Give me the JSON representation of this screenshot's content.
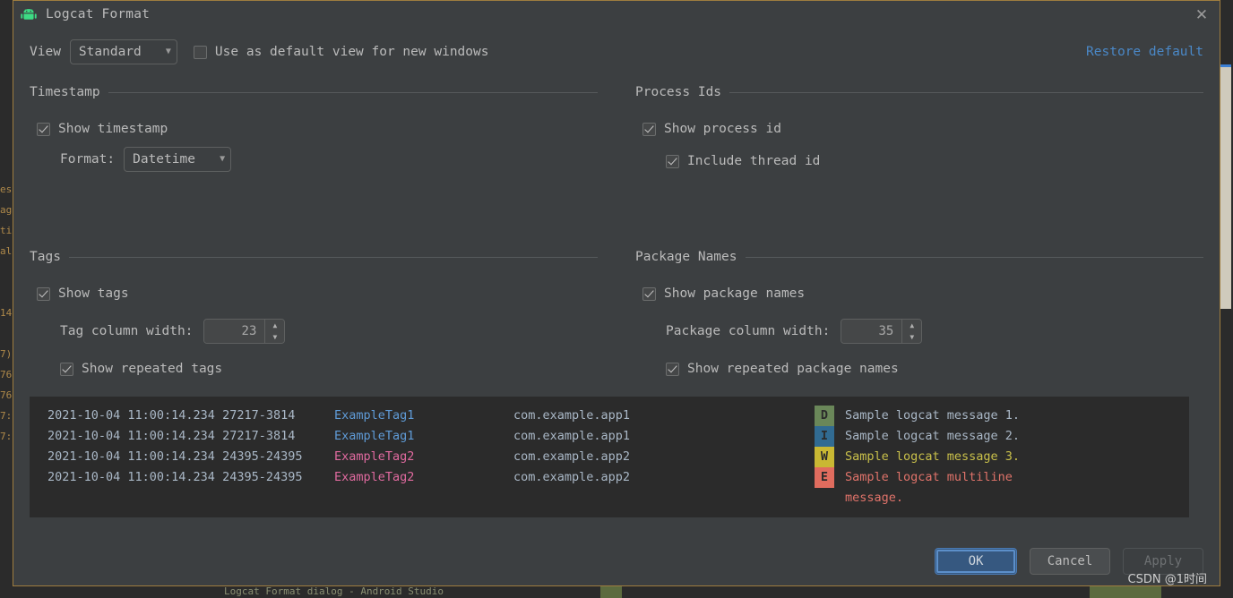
{
  "window": {
    "title": "Logcat Format",
    "icon": "android-robot-icon",
    "close_label": "✕"
  },
  "toolbar": {
    "view_label": "View",
    "view_value": "Standard",
    "default_view_checkbox": "Use as default view for new windows",
    "default_view_checked": false,
    "restore_default": "Restore default"
  },
  "timestamp": {
    "section_title": "Timestamp",
    "show_label": "Show timestamp",
    "show_checked": true,
    "format_label": "Format:",
    "format_value": "Datetime"
  },
  "process_ids": {
    "section_title": "Process Ids",
    "show_label": "Show process id",
    "show_checked": true,
    "thread_label": "Include thread id",
    "thread_checked": true
  },
  "tags": {
    "section_title": "Tags",
    "show_label": "Show tags",
    "show_checked": true,
    "width_label": "Tag column width:",
    "width_value": "23",
    "repeated_label": "Show repeated tags",
    "repeated_checked": true
  },
  "package_names": {
    "section_title": "Package Names",
    "show_label": "Show package names",
    "show_checked": true,
    "width_label": "Package column width:",
    "width_value": "35",
    "repeated_label": "Show repeated package names",
    "repeated_checked": true
  },
  "preview": {
    "rows": [
      {
        "timestamp": "2021-10-04 11:00:14.234 27217-3814 ",
        "tag": "ExampleTag1",
        "tag_color": "#5f9bd7",
        "package": "com.example.app1",
        "level": "D",
        "level_bg": "#6a8759",
        "message": "Sample logcat message 1.",
        "message_color": "#a9b7c6"
      },
      {
        "timestamp": "2021-10-04 11:00:14.234 27217-3814 ",
        "tag": "ExampleTag1",
        "tag_color": "#5f9bd7",
        "package": "com.example.app1",
        "level": "I",
        "level_bg": "#316b92",
        "message": "Sample logcat message 2.",
        "message_color": "#a9b7c6"
      },
      {
        "timestamp": "2021-10-04 11:00:14.234 24395-24395",
        "tag": "ExampleTag2",
        "tag_color": "#e06a9f",
        "package": "com.example.app2",
        "level": "W",
        "level_bg": "#c9b833",
        "message": "Sample logcat message 3.",
        "message_color": "#c9c04a"
      },
      {
        "timestamp": "2021-10-04 11:00:14.234 24395-24395",
        "tag": "ExampleTag2",
        "tag_color": "#e06a9f",
        "package": "com.example.app2",
        "level": "E",
        "level_bg": "#e06c5e",
        "message": "Sample logcat multiline",
        "message_color": "#e0736a"
      }
    ],
    "continuation": "message.",
    "continuation_color": "#e0736a"
  },
  "footer": {
    "ok": "OK",
    "cancel": "Cancel",
    "apply": "Apply"
  },
  "watermark": "CSDN @1时间",
  "spinner": {
    "up": "▲",
    "down": "▼"
  },
  "icons": {
    "caret_down": "▼"
  },
  "background": {
    "left_text": "es\nag\nti\nal\n\n\n14\n\n7)\n76\n76\n7:\n7:",
    "bottom_text": "Logcat Format dialog - Android Studio"
  }
}
